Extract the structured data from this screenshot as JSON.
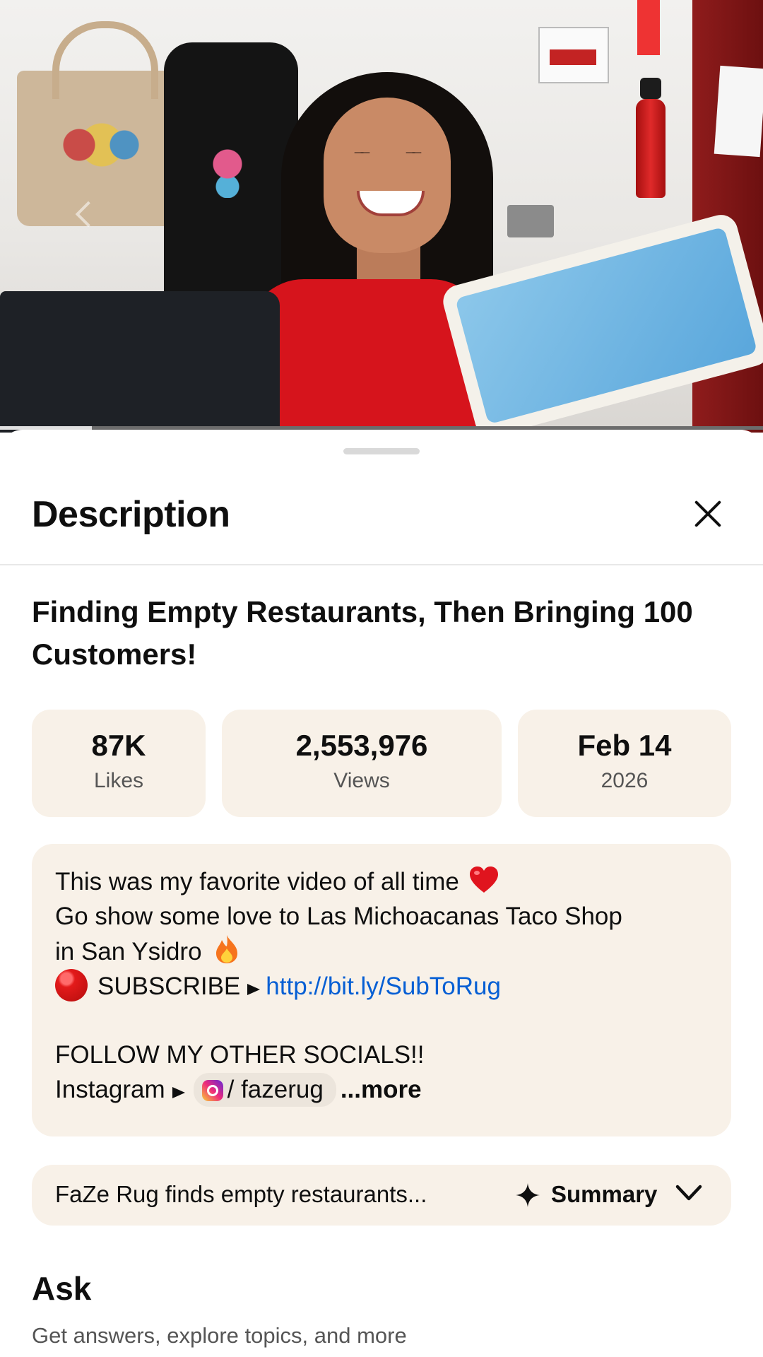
{
  "video": {
    "progress_fraction": 0.12
  },
  "sheet": {
    "title": "Description"
  },
  "video_title": "Finding Empty Restaurants, Then Bringing 100 Customers!",
  "stats": {
    "likes_value": "87K",
    "likes_label": "Likes",
    "views_value": "2,553,976",
    "views_label": "Views",
    "date_value": "Feb 14",
    "date_label": "2026"
  },
  "description": {
    "line1": "This was my favorite video of all time",
    "line2": "Go show some love to Las Michoacanas Taco Shop",
    "line3": "in San Ysidro",
    "subscribe_label": "SUBSCRIBE",
    "subscribe_link": "http://bit.ly/SubToRug",
    "follow": "FOLLOW MY OTHER SOCIALS!!",
    "instagram_label": "Instagram",
    "instagram_handle": "/ fazerug",
    "more": "...more"
  },
  "summary": {
    "text": "FaZe Rug finds empty restaurants...",
    "button": "Summary"
  },
  "ask": {
    "title": "Ask",
    "subtitle": "Get answers, explore topics, and more"
  },
  "colors": {
    "card_bg": "#f8f1e8",
    "link": "#065fd4",
    "text": "#0f0f0f"
  },
  "icons": [
    "close-icon",
    "heart-icon",
    "fire-icon",
    "red-dot-icon",
    "play-arrow-icon",
    "instagram-icon",
    "sparkle-icon",
    "chevron-down-icon",
    "chevron-left-icon"
  ]
}
